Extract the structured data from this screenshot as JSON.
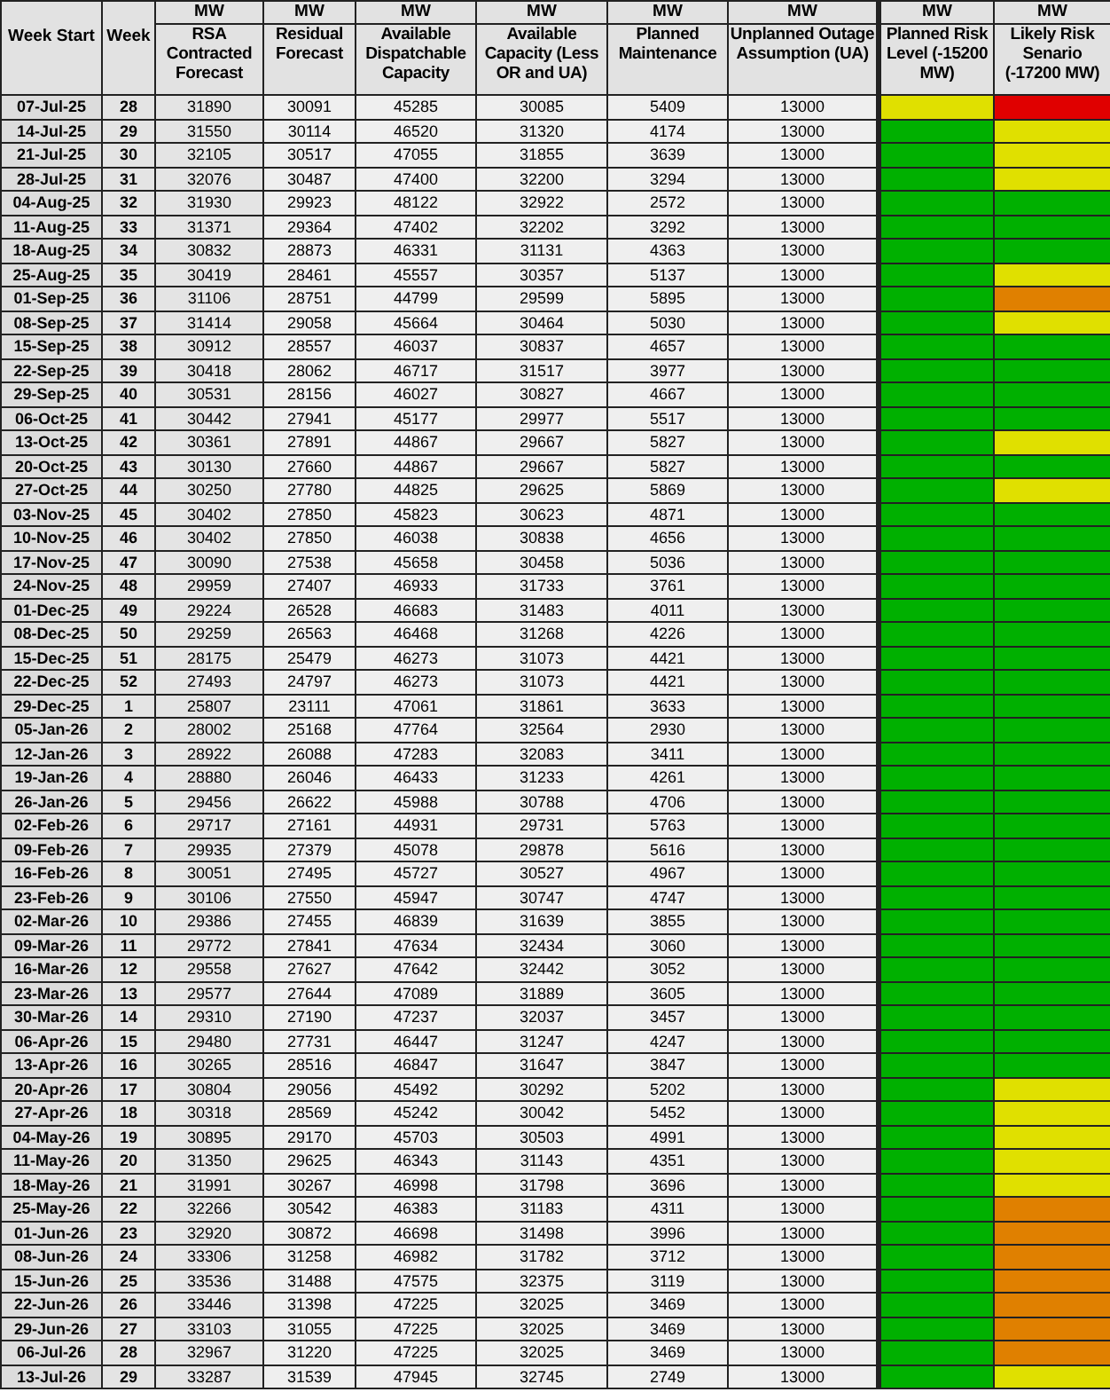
{
  "columns": [
    {
      "label": "Week Start"
    },
    {
      "label": "Week"
    },
    {
      "unit": "MW",
      "label": "RSA Contracted Forecast"
    },
    {
      "unit": "MW",
      "label": "Residual Forecast"
    },
    {
      "unit": "MW",
      "label": "Available Dispatchable Capacity"
    },
    {
      "unit": "MW",
      "label": "Available Capacity (Less OR and UA)"
    },
    {
      "unit": "MW",
      "label": "Planned Maintenance"
    },
    {
      "unit": "MW",
      "label": "Unplanned Outage Assumption (UA)"
    },
    {
      "unit": "MW",
      "label": "Planned Risk Level (-15200 MW)"
    },
    {
      "unit": "MW",
      "label": "Likely Risk Senario (-17200 MW)"
    }
  ],
  "rows": [
    {
      "week_start": "07-Jul-25",
      "week": "28",
      "values": [
        "31890",
        "30091",
        "45285",
        "30085",
        "5409",
        "13000"
      ],
      "planned_risk": {
        "color": "#e0e000"
      },
      "likely_risk": {
        "color": "#e00000"
      }
    },
    {
      "week_start": "14-Jul-25",
      "week": "29",
      "values": [
        "31550",
        "30114",
        "46520",
        "31320",
        "4174",
        "13000"
      ],
      "planned_risk": {
        "color": "#00b000"
      },
      "likely_risk": {
        "color": "#e0e000"
      }
    },
    {
      "week_start": "21-Jul-25",
      "week": "30",
      "values": [
        "32105",
        "30517",
        "47055",
        "31855",
        "3639",
        "13000"
      ],
      "planned_risk": {
        "color": "#00b000"
      },
      "likely_risk": {
        "color": "#e0e000"
      }
    },
    {
      "week_start": "28-Jul-25",
      "week": "31",
      "values": [
        "32076",
        "30487",
        "47400",
        "32200",
        "3294",
        "13000"
      ],
      "planned_risk": {
        "color": "#00b000"
      },
      "likely_risk": {
        "color": "#e0e000"
      }
    },
    {
      "week_start": "04-Aug-25",
      "week": "32",
      "values": [
        "31930",
        "29923",
        "48122",
        "32922",
        "2572",
        "13000"
      ],
      "planned_risk": {
        "color": "#00b000"
      },
      "likely_risk": {
        "color": "#00b000"
      }
    },
    {
      "week_start": "11-Aug-25",
      "week": "33",
      "values": [
        "31371",
        "29364",
        "47402",
        "32202",
        "3292",
        "13000"
      ],
      "planned_risk": {
        "color": "#00b000"
      },
      "likely_risk": {
        "color": "#00b000"
      }
    },
    {
      "week_start": "18-Aug-25",
      "week": "34",
      "values": [
        "30832",
        "28873",
        "46331",
        "31131",
        "4363",
        "13000"
      ],
      "planned_risk": {
        "color": "#00b000"
      },
      "likely_risk": {
        "color": "#00b000"
      }
    },
    {
      "week_start": "25-Aug-25",
      "week": "35",
      "values": [
        "30419",
        "28461",
        "45557",
        "30357",
        "5137",
        "13000"
      ],
      "planned_risk": {
        "color": "#00b000"
      },
      "likely_risk": {
        "color": "#e0e000"
      }
    },
    {
      "week_start": "01-Sep-25",
      "week": "36",
      "values": [
        "31106",
        "28751",
        "44799",
        "29599",
        "5895",
        "13000"
      ],
      "planned_risk": {
        "color": "#00b000"
      },
      "likely_risk": {
        "color": "#e08000"
      }
    },
    {
      "week_start": "08-Sep-25",
      "week": "37",
      "values": [
        "31414",
        "29058",
        "45664",
        "30464",
        "5030",
        "13000"
      ],
      "planned_risk": {
        "color": "#00b000"
      },
      "likely_risk": {
        "color": "#e0e000"
      }
    },
    {
      "week_start": "15-Sep-25",
      "week": "38",
      "values": [
        "30912",
        "28557",
        "46037",
        "30837",
        "4657",
        "13000"
      ],
      "planned_risk": {
        "color": "#00b000"
      },
      "likely_risk": {
        "color": "#00b000"
      }
    },
    {
      "week_start": "22-Sep-25",
      "week": "39",
      "values": [
        "30418",
        "28062",
        "46717",
        "31517",
        "3977",
        "13000"
      ],
      "planned_risk": {
        "color": "#00b000"
      },
      "likely_risk": {
        "color": "#00b000"
      }
    },
    {
      "week_start": "29-Sep-25",
      "week": "40",
      "values": [
        "30531",
        "28156",
        "46027",
        "30827",
        "4667",
        "13000"
      ],
      "planned_risk": {
        "color": "#00b000"
      },
      "likely_risk": {
        "color": "#00b000"
      }
    },
    {
      "week_start": "06-Oct-25",
      "week": "41",
      "values": [
        "30442",
        "27941",
        "45177",
        "29977",
        "5517",
        "13000"
      ],
      "planned_risk": {
        "color": "#00b000"
      },
      "likely_risk": {
        "color": "#00b000"
      }
    },
    {
      "week_start": "13-Oct-25",
      "week": "42",
      "values": [
        "30361",
        "27891",
        "44867",
        "29667",
        "5827",
        "13000"
      ],
      "planned_risk": {
        "color": "#00b000"
      },
      "likely_risk": {
        "color": "#e0e000"
      }
    },
    {
      "week_start": "20-Oct-25",
      "week": "43",
      "values": [
        "30130",
        "27660",
        "44867",
        "29667",
        "5827",
        "13000"
      ],
      "planned_risk": {
        "color": "#00b000"
      },
      "likely_risk": {
        "color": "#00b000"
      }
    },
    {
      "week_start": "27-Oct-25",
      "week": "44",
      "values": [
        "30250",
        "27780",
        "44825",
        "29625",
        "5869",
        "13000"
      ],
      "planned_risk": {
        "color": "#00b000"
      },
      "likely_risk": {
        "color": "#e0e000"
      }
    },
    {
      "week_start": "03-Nov-25",
      "week": "45",
      "values": [
        "30402",
        "27850",
        "45823",
        "30623",
        "4871",
        "13000"
      ],
      "planned_risk": {
        "color": "#00b000"
      },
      "likely_risk": {
        "color": "#00b000"
      }
    },
    {
      "week_start": "10-Nov-25",
      "week": "46",
      "values": [
        "30402",
        "27850",
        "46038",
        "30838",
        "4656",
        "13000"
      ],
      "planned_risk": {
        "color": "#00b000"
      },
      "likely_risk": {
        "color": "#00b000"
      }
    },
    {
      "week_start": "17-Nov-25",
      "week": "47",
      "values": [
        "30090",
        "27538",
        "45658",
        "30458",
        "5036",
        "13000"
      ],
      "planned_risk": {
        "color": "#00b000"
      },
      "likely_risk": {
        "color": "#00b000"
      }
    },
    {
      "week_start": "24-Nov-25",
      "week": "48",
      "values": [
        "29959",
        "27407",
        "46933",
        "31733",
        "3761",
        "13000"
      ],
      "planned_risk": {
        "color": "#00b000"
      },
      "likely_risk": {
        "color": "#00b000"
      }
    },
    {
      "week_start": "01-Dec-25",
      "week": "49",
      "values": [
        "29224",
        "26528",
        "46683",
        "31483",
        "4011",
        "13000"
      ],
      "planned_risk": {
        "color": "#00b000"
      },
      "likely_risk": {
        "color": "#00b000"
      }
    },
    {
      "week_start": "08-Dec-25",
      "week": "50",
      "values": [
        "29259",
        "26563",
        "46468",
        "31268",
        "4226",
        "13000"
      ],
      "planned_risk": {
        "color": "#00b000"
      },
      "likely_risk": {
        "color": "#00b000"
      }
    },
    {
      "week_start": "15-Dec-25",
      "week": "51",
      "values": [
        "28175",
        "25479",
        "46273",
        "31073",
        "4421",
        "13000"
      ],
      "planned_risk": {
        "color": "#00b000"
      },
      "likely_risk": {
        "color": "#00b000"
      }
    },
    {
      "week_start": "22-Dec-25",
      "week": "52",
      "values": [
        "27493",
        "24797",
        "46273",
        "31073",
        "4421",
        "13000"
      ],
      "planned_risk": {
        "color": "#00b000"
      },
      "likely_risk": {
        "color": "#00b000"
      }
    },
    {
      "week_start": "29-Dec-25",
      "week": "1",
      "values": [
        "25807",
        "23111",
        "47061",
        "31861",
        "3633",
        "13000"
      ],
      "planned_risk": {
        "color": "#00b000"
      },
      "likely_risk": {
        "color": "#00b000"
      }
    },
    {
      "week_start": "05-Jan-26",
      "week": "2",
      "values": [
        "28002",
        "25168",
        "47764",
        "32564",
        "2930",
        "13000"
      ],
      "planned_risk": {
        "color": "#00b000"
      },
      "likely_risk": {
        "color": "#00b000"
      }
    },
    {
      "week_start": "12-Jan-26",
      "week": "3",
      "values": [
        "28922",
        "26088",
        "47283",
        "32083",
        "3411",
        "13000"
      ],
      "planned_risk": {
        "color": "#00b000"
      },
      "likely_risk": {
        "color": "#00b000"
      }
    },
    {
      "week_start": "19-Jan-26",
      "week": "4",
      "values": [
        "28880",
        "26046",
        "46433",
        "31233",
        "4261",
        "13000"
      ],
      "planned_risk": {
        "color": "#00b000"
      },
      "likely_risk": {
        "color": "#00b000"
      }
    },
    {
      "week_start": "26-Jan-26",
      "week": "5",
      "values": [
        "29456",
        "26622",
        "45988",
        "30788",
        "4706",
        "13000"
      ],
      "planned_risk": {
        "color": "#00b000"
      },
      "likely_risk": {
        "color": "#00b000"
      }
    },
    {
      "week_start": "02-Feb-26",
      "week": "6",
      "values": [
        "29717",
        "27161",
        "44931",
        "29731",
        "5763",
        "13000"
      ],
      "planned_risk": {
        "color": "#00b000"
      },
      "likely_risk": {
        "color": "#00b000"
      }
    },
    {
      "week_start": "09-Feb-26",
      "week": "7",
      "values": [
        "29935",
        "27379",
        "45078",
        "29878",
        "5616",
        "13000"
      ],
      "planned_risk": {
        "color": "#00b000"
      },
      "likely_risk": {
        "color": "#00b000"
      }
    },
    {
      "week_start": "16-Feb-26",
      "week": "8",
      "values": [
        "30051",
        "27495",
        "45727",
        "30527",
        "4967",
        "13000"
      ],
      "planned_risk": {
        "color": "#00b000"
      },
      "likely_risk": {
        "color": "#00b000"
      }
    },
    {
      "week_start": "23-Feb-26",
      "week": "9",
      "values": [
        "30106",
        "27550",
        "45947",
        "30747",
        "4747",
        "13000"
      ],
      "planned_risk": {
        "color": "#00b000"
      },
      "likely_risk": {
        "color": "#00b000"
      }
    },
    {
      "week_start": "02-Mar-26",
      "week": "10",
      "values": [
        "29386",
        "27455",
        "46839",
        "31639",
        "3855",
        "13000"
      ],
      "planned_risk": {
        "color": "#00b000"
      },
      "likely_risk": {
        "color": "#00b000"
      }
    },
    {
      "week_start": "09-Mar-26",
      "week": "11",
      "values": [
        "29772",
        "27841",
        "47634",
        "32434",
        "3060",
        "13000"
      ],
      "planned_risk": {
        "color": "#00b000"
      },
      "likely_risk": {
        "color": "#00b000"
      }
    },
    {
      "week_start": "16-Mar-26",
      "week": "12",
      "values": [
        "29558",
        "27627",
        "47642",
        "32442",
        "3052",
        "13000"
      ],
      "planned_risk": {
        "color": "#00b000"
      },
      "likely_risk": {
        "color": "#00b000"
      }
    },
    {
      "week_start": "23-Mar-26",
      "week": "13",
      "values": [
        "29577",
        "27644",
        "47089",
        "31889",
        "3605",
        "13000"
      ],
      "planned_risk": {
        "color": "#00b000"
      },
      "likely_risk": {
        "color": "#00b000"
      }
    },
    {
      "week_start": "30-Mar-26",
      "week": "14",
      "values": [
        "29310",
        "27190",
        "47237",
        "32037",
        "3457",
        "13000"
      ],
      "planned_risk": {
        "color": "#00b000"
      },
      "likely_risk": {
        "color": "#00b000"
      }
    },
    {
      "week_start": "06-Apr-26",
      "week": "15",
      "values": [
        "29480",
        "27731",
        "46447",
        "31247",
        "4247",
        "13000"
      ],
      "planned_risk": {
        "color": "#00b000"
      },
      "likely_risk": {
        "color": "#00b000"
      }
    },
    {
      "week_start": "13-Apr-26",
      "week": "16",
      "values": [
        "30265",
        "28516",
        "46847",
        "31647",
        "3847",
        "13000"
      ],
      "planned_risk": {
        "color": "#00b000"
      },
      "likely_risk": {
        "color": "#00b000"
      }
    },
    {
      "week_start": "20-Apr-26",
      "week": "17",
      "values": [
        "30804",
        "29056",
        "45492",
        "30292",
        "5202",
        "13000"
      ],
      "planned_risk": {
        "color": "#00b000"
      },
      "likely_risk": {
        "color": "#e0e000"
      }
    },
    {
      "week_start": "27-Apr-26",
      "week": "18",
      "values": [
        "30318",
        "28569",
        "45242",
        "30042",
        "5452",
        "13000"
      ],
      "planned_risk": {
        "color": "#00b000"
      },
      "likely_risk": {
        "color": "#e0e000"
      }
    },
    {
      "week_start": "04-May-26",
      "week": "19",
      "values": [
        "30895",
        "29170",
        "45703",
        "30503",
        "4991",
        "13000"
      ],
      "planned_risk": {
        "color": "#00b000"
      },
      "likely_risk": {
        "color": "#e0e000"
      }
    },
    {
      "week_start": "11-May-26",
      "week": "20",
      "values": [
        "31350",
        "29625",
        "46343",
        "31143",
        "4351",
        "13000"
      ],
      "planned_risk": {
        "color": "#00b000"
      },
      "likely_risk": {
        "color": "#e0e000"
      }
    },
    {
      "week_start": "18-May-26",
      "week": "21",
      "values": [
        "31991",
        "30267",
        "46998",
        "31798",
        "3696",
        "13000"
      ],
      "planned_risk": {
        "color": "#00b000"
      },
      "likely_risk": {
        "color": "#e0e000"
      }
    },
    {
      "week_start": "25-May-26",
      "week": "22",
      "values": [
        "32266",
        "30542",
        "46383",
        "31183",
        "4311",
        "13000"
      ],
      "planned_risk": {
        "color": "#00b000"
      },
      "likely_risk": {
        "color": "#e08000"
      }
    },
    {
      "week_start": "01-Jun-26",
      "week": "23",
      "values": [
        "32920",
        "30872",
        "46698",
        "31498",
        "3996",
        "13000"
      ],
      "planned_risk": {
        "color": "#00b000"
      },
      "likely_risk": {
        "color": "#e08000"
      }
    },
    {
      "week_start": "08-Jun-26",
      "week": "24",
      "values": [
        "33306",
        "31258",
        "46982",
        "31782",
        "3712",
        "13000"
      ],
      "planned_risk": {
        "color": "#00b000"
      },
      "likely_risk": {
        "color": "#e08000"
      }
    },
    {
      "week_start": "15-Jun-26",
      "week": "25",
      "values": [
        "33536",
        "31488",
        "47575",
        "32375",
        "3119",
        "13000"
      ],
      "planned_risk": {
        "color": "#00b000"
      },
      "likely_risk": {
        "color": "#e08000"
      }
    },
    {
      "week_start": "22-Jun-26",
      "week": "26",
      "values": [
        "33446",
        "31398",
        "47225",
        "32025",
        "3469",
        "13000"
      ],
      "planned_risk": {
        "color": "#00b000"
      },
      "likely_risk": {
        "color": "#e08000"
      }
    },
    {
      "week_start": "29-Jun-26",
      "week": "27",
      "values": [
        "33103",
        "31055",
        "47225",
        "32025",
        "3469",
        "13000"
      ],
      "planned_risk": {
        "color": "#00b000"
      },
      "likely_risk": {
        "color": "#e08000"
      }
    },
    {
      "week_start": "06-Jul-26",
      "week": "28",
      "values": [
        "32967",
        "31220",
        "47225",
        "32025",
        "3469",
        "13000"
      ],
      "planned_risk": {
        "color": "#00b000"
      },
      "likely_risk": {
        "color": "#e08000"
      }
    },
    {
      "week_start": "13-Jul-26",
      "week": "29",
      "values": [
        "33287",
        "31539",
        "47945",
        "32745",
        "2749",
        "13000"
      ],
      "planned_risk": {
        "color": "#00b000"
      },
      "likely_risk": {
        "color": "#e0e000"
      }
    }
  ]
}
